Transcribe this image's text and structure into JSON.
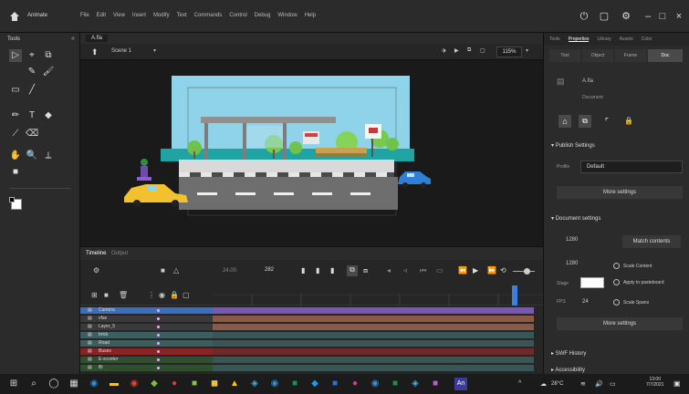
{
  "app": {
    "name": "Animate"
  },
  "menu": [
    "File",
    "Edit",
    "View",
    "Insert",
    "Modify",
    "Text",
    "Commands",
    "Control",
    "Debug",
    "Window",
    "Help"
  ],
  "tools_panel": {
    "title": "Tools"
  },
  "document": {
    "tab": "A.fla",
    "scene": "Scene 1",
    "zoom": "115%"
  },
  "timeline": {
    "tabs": [
      "Timeline",
      "Output"
    ],
    "fps": "24.00",
    "frame": "282",
    "layers": [
      {
        "name": "Camera",
        "color": "#3b6ebd"
      },
      {
        "name": "vfax",
        "color": "#3a3a3a"
      },
      {
        "name": "Layer_5",
        "color": "#3a3a3a"
      },
      {
        "name": "brick",
        "color": "#3c5e5e"
      },
      {
        "name": "Road",
        "color": "#3c5e5e"
      },
      {
        "name": "Buses",
        "color": "#8a2323"
      },
      {
        "name": "E-scooter",
        "color": "#2f4f2f"
      },
      {
        "name": "Bl",
        "color": "#2f4f2f"
      }
    ]
  },
  "properties": {
    "tabs": [
      "Tools",
      "Properties",
      "Library",
      "Assets",
      "Color"
    ],
    "active_tab": "Properties",
    "subtabs": [
      "Tool",
      "Object",
      "Frame",
      "Doc"
    ],
    "active_subtab": "Doc",
    "doc_name": "A.fla",
    "doc_type": "Document",
    "doc_settings_label": "Document settings",
    "publish_settings_label": "Publish Settings",
    "target_label": "Profile",
    "target_value": "Default",
    "more_settings": "More settings",
    "width_value": "1280",
    "height_value": "1280",
    "match_contents": "Match contents",
    "scale_content": "Scale Content",
    "apply_pasteboard": "Apply to pasteboard",
    "scale_spans": "Scale Spans",
    "stage_label": "Stage",
    "fps_label": "FPS",
    "fps_value": "24",
    "more_settings_2": "More settings",
    "swf_history": "SWF History",
    "accessibility": "Accessibility"
  },
  "taskbar": {
    "temp": "28°C",
    "time": "13:00",
    "date": "7/7/2021"
  }
}
